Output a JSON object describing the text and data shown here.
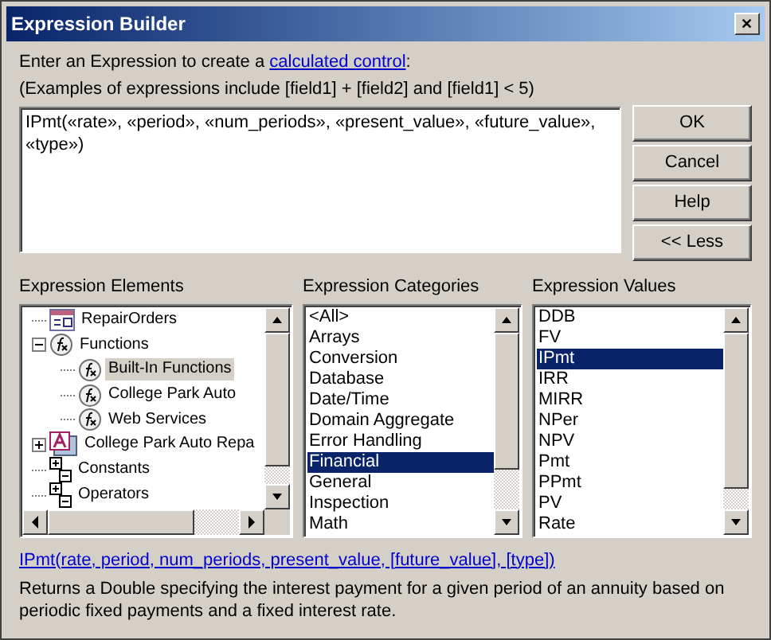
{
  "window": {
    "title": "Expression Builder",
    "close": "✕"
  },
  "intro": {
    "before": "Enter an Expression to create a ",
    "link": "calculated control",
    "after": ":"
  },
  "examples": "(Examples of expressions include [field1] + [field2] and [field1] < 5)",
  "expression": "IPmt(«rate», «period», «num_periods», «present_value», «future_value», «type»)",
  "buttons": [
    "OK",
    "Cancel",
    "Help",
    "<< Less"
  ],
  "elements": {
    "label": "Expression Elements",
    "items": [
      {
        "label": "RepairOrders",
        "kind": "table",
        "selected": false
      },
      {
        "label": "Functions",
        "kind": "function",
        "expanded": true,
        "selected": false,
        "children": [
          {
            "label": "Built-In Functions",
            "kind": "function",
            "selected": true
          },
          {
            "label": "College Park Auto",
            "kind": "function",
            "selected": false
          },
          {
            "label": "Web Services",
            "kind": "function",
            "selected": false
          }
        ]
      },
      {
        "label": "College Park Auto Repa",
        "kind": "form",
        "expanded": false,
        "selected": false
      },
      {
        "label": "Constants",
        "kind": "plusminus",
        "selected": false
      },
      {
        "label": "Operators",
        "kind": "plusminus",
        "selected": false
      }
    ]
  },
  "categories": {
    "label": "Expression Categories",
    "items": [
      {
        "label": "<All>",
        "selected": false
      },
      {
        "label": "Arrays",
        "selected": false
      },
      {
        "label": "Conversion",
        "selected": false
      },
      {
        "label": "Database",
        "selected": false
      },
      {
        "label": "Date/Time",
        "selected": false
      },
      {
        "label": "Domain Aggregate",
        "selected": false
      },
      {
        "label": "Error Handling",
        "selected": false
      },
      {
        "label": "Financial",
        "selected": true
      },
      {
        "label": "General",
        "selected": false
      },
      {
        "label": "Inspection",
        "selected": false
      },
      {
        "label": "Math",
        "selected": false
      }
    ]
  },
  "values": {
    "label": "Expression Values",
    "items": [
      {
        "label": "DDB",
        "selected": false
      },
      {
        "label": "FV",
        "selected": false
      },
      {
        "label": "IPmt",
        "selected": true
      },
      {
        "label": "IRR",
        "selected": false
      },
      {
        "label": "MIRR",
        "selected": false
      },
      {
        "label": "NPer",
        "selected": false
      },
      {
        "label": "NPV",
        "selected": false
      },
      {
        "label": "Pmt",
        "selected": false
      },
      {
        "label": "PPmt",
        "selected": false
      },
      {
        "label": "PV",
        "selected": false
      },
      {
        "label": "Rate",
        "selected": false
      }
    ]
  },
  "syntax_link": "IPmt(rate, period, num_periods, present_value, [future_value], [type])",
  "description": "Returns a Double specifying the interest payment for a given period of an annuity based on periodic fixed payments and a fixed interest rate."
}
